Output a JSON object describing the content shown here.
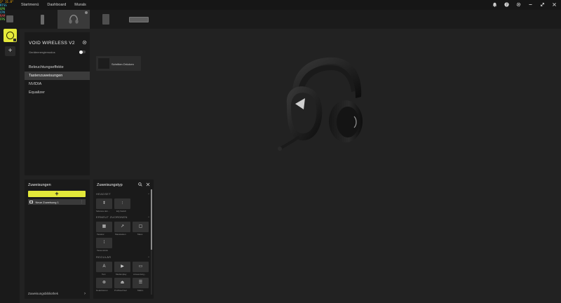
{
  "hud": {
    "line1": "3° 31.8°",
    "line2": "RTSS",
    "line3": "GPU",
    "line4": "CPU",
    "line5": "RAM",
    "line6": "FPS"
  },
  "nav": {
    "items": [
      "Startmenü",
      "Dashboard",
      "Murals"
    ]
  },
  "device_panel": {
    "title": "VOID WIRELESS V2",
    "sleep_label": "Geräteenergiemodus",
    "menu": [
      {
        "label": "Beleuchtungseffekte",
        "active": false
      },
      {
        "label": "Tastenzuweisungen",
        "active": true
      },
      {
        "label": "NVIDIA",
        "active": false
      },
      {
        "label": "Equalizer",
        "active": false
      }
    ]
  },
  "center": {
    "action_card_label": "Schritten Drücken"
  },
  "assign_panel": {
    "title": "Zuweisungen",
    "add_label": "+",
    "rows": [
      {
        "label": "Neue Zuweisung 1"
      }
    ],
    "library_label": "Zuweisungsbibliothek"
  },
  "type_panel": {
    "title": "Zuweisungstyp",
    "sections": [
      {
        "label": "HEADSET"
      },
      {
        "label": "ERNEUT ZUORDNEN"
      },
      {
        "label": "REGULÄR"
      }
    ],
    "headset_tiles": [
      {
        "label": "Sidetone Ein..."
      },
      {
        "label": "EQ-Switch"
      }
    ],
    "remap_tiles": [
      {
        "label": "Tastatur"
      },
      {
        "label": "Maustasten"
      },
      {
        "label": "Maus"
      },
      {
        "label": "Tastenstück"
      }
    ],
    "regular_tiles": [
      {
        "label": "Text"
      },
      {
        "label": "Medienplay"
      },
      {
        "label": "Anwendung..."
      },
      {
        "label": "Deaktivieren"
      },
      {
        "label": "Profilwechsel"
      },
      {
        "label": "Makro"
      }
    ]
  }
}
